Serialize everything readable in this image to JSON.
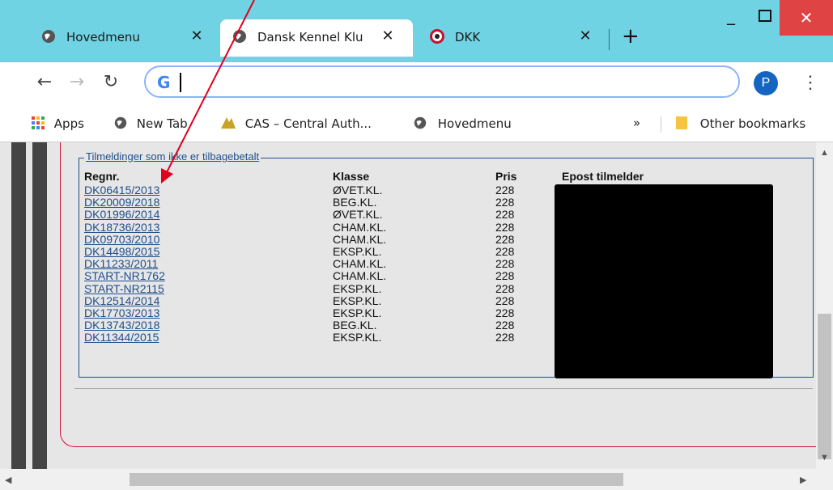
{
  "tabs": [
    {
      "label": "Hovedmenu",
      "icon": "globe-icon"
    },
    {
      "label": "Dansk Kennel Klu",
      "icon": "globe-icon"
    },
    {
      "label": "DKK",
      "icon": "dkk-logo-icon"
    }
  ],
  "toolbar": {
    "address_value": "",
    "avatar_letter": "P"
  },
  "bookmarks": {
    "apps": "Apps",
    "new_tab": "New Tab",
    "cas": "CAS – Central Auth...",
    "hovedmenu": "Hovedmenu",
    "more": "»",
    "other": "Other bookmarks"
  },
  "section": {
    "legend": "Tilmeldinger som ikke er tilbagebetalt",
    "headers": {
      "regnr": "Regnr.",
      "klasse": "Klasse",
      "pris": "Pris",
      "epost": "Epost tilmelder"
    }
  },
  "rows": [
    {
      "regnr": "DK06415/2013",
      "klasse": "ØVET.KL.",
      "pris": "228"
    },
    {
      "regnr": "DK20009/2018",
      "klasse": "BEG.KL.",
      "pris": "228"
    },
    {
      "regnr": "DK01996/2014",
      "klasse": "ØVET.KL.",
      "pris": "228"
    },
    {
      "regnr": "DK18736/2013",
      "klasse": "CHAM.KL.",
      "pris": "228"
    },
    {
      "regnr": "DK09703/2010",
      "klasse": "CHAM.KL.",
      "pris": "228"
    },
    {
      "regnr": "DK14498/2015",
      "klasse": "EKSP.KL.",
      "pris": "228"
    },
    {
      "regnr": "DK11233/2011",
      "klasse": "CHAM.KL.",
      "pris": "228"
    },
    {
      "regnr": "START-NR1762",
      "klasse": "CHAM.KL.",
      "pris": "228"
    },
    {
      "regnr": "START-NR2115",
      "klasse": "EKSP.KL.",
      "pris": "228"
    },
    {
      "regnr": "DK12514/2014",
      "klasse": "EKSP.KL.",
      "pris": "228"
    },
    {
      "regnr": "DK17703/2013",
      "klasse": "EKSP.KL.",
      "pris": "228"
    },
    {
      "regnr": "DK13743/2018",
      "klasse": "BEG.KL.",
      "pris": "228"
    },
    {
      "regnr": "DK11344/2015",
      "klasse": "EKSP.KL.",
      "pris": "228"
    }
  ],
  "colors": {
    "tabstrip": "#6fd3e3",
    "link": "#1f4e8c",
    "panel_border": "#c8102e",
    "annotation_arrow": "#e0001b"
  }
}
